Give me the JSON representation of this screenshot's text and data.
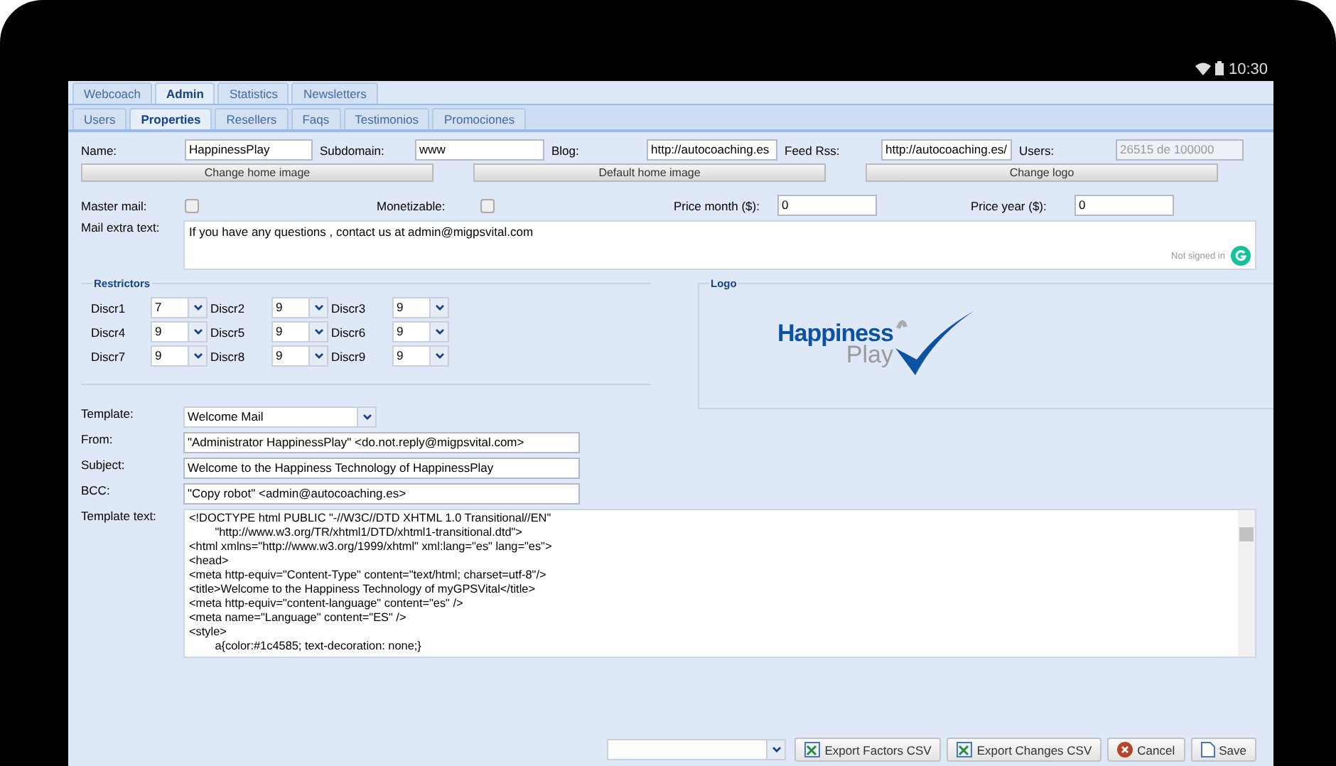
{
  "status_bar": {
    "time": "10:30"
  },
  "main_tabs": [
    {
      "label": "Webcoach",
      "selected": false
    },
    {
      "label": "Admin",
      "selected": true
    },
    {
      "label": "Statistics",
      "selected": false
    },
    {
      "label": "Newsletters",
      "selected": false
    }
  ],
  "sub_tabs": [
    {
      "label": "Users",
      "selected": false
    },
    {
      "label": "Properties",
      "selected": true
    },
    {
      "label": "Resellers",
      "selected": false
    },
    {
      "label": "Faqs",
      "selected": false
    },
    {
      "label": "Testimonios",
      "selected": false
    },
    {
      "label": "Promociones",
      "selected": false
    }
  ],
  "top_fields": [
    {
      "label": "Name:",
      "value": "HappinessPlay",
      "disabled": false
    },
    {
      "label": "Subdomain:",
      "value": "www",
      "disabled": false
    },
    {
      "label": "Blog:",
      "value": "http://autocoaching.es",
      "disabled": false
    },
    {
      "label": "Feed Rss:",
      "value": "http://autocoaching.es/",
      "disabled": false
    },
    {
      "label": "Users:",
      "value": "26515 de 100000",
      "disabled": true
    }
  ],
  "image_buttons": [
    "Change home image",
    "Default home image",
    "Change logo"
  ],
  "checkboxes": [
    {
      "label": "Master mail:",
      "checked": false
    },
    {
      "label": "Monetizable:",
      "checked": false
    }
  ],
  "price_fields": [
    {
      "label": "Price month ($):",
      "value": "0"
    },
    {
      "label": "Price year ($):",
      "value": "0"
    }
  ],
  "mail_extra_text": {
    "label": "Mail extra text:",
    "value": "If you have any questions , contact us at admin@migpsvital.com",
    "grammar_status": "Not signed in"
  },
  "restrictors": {
    "title": "Restrictors",
    "items": [
      {
        "label": "Discr1",
        "value": "7"
      },
      {
        "label": "Discr2",
        "value": "9"
      },
      {
        "label": "Discr3",
        "value": "9"
      },
      {
        "label": "Discr4",
        "value": "9"
      },
      {
        "label": "Discr5",
        "value": "9"
      },
      {
        "label": "Discr6",
        "value": "9"
      },
      {
        "label": "Discr7",
        "value": "9"
      },
      {
        "label": "Discr8",
        "value": "9"
      },
      {
        "label": "Discr9",
        "value": "9"
      }
    ]
  },
  "logo": {
    "title": "Logo",
    "brand_top": "Happiness",
    "brand_bottom": "Play"
  },
  "template_form": {
    "template": {
      "label": "Template:",
      "value": "Welcome Mail"
    },
    "fields": [
      {
        "label": "From:",
        "value": "\"Administrator HappinessPlay\" <do.not.reply@migpsvital.com>"
      },
      {
        "label": "Subject:",
        "value": "Welcome to the Happiness Technology of HappinessPlay"
      },
      {
        "label": "BCC:",
        "value": "\"Copy robot\" <admin@autocoaching.es>"
      }
    ],
    "template_text": {
      "label": "Template text:",
      "lines": [
        "<!DOCTYPE html PUBLIC \"-//W3C//DTD XHTML 1.0 Transitional//EN\"",
        "        \"http://www.w3.org/TR/xhtml1/DTD/xhtml1-transitional.dtd\">",
        "<html xmlns=\"http://www.w3.org/1999/xhtml\" xml:lang=\"es\" lang=\"es\">",
        "<head>",
        "<meta http-equiv=\"Content-Type\" content=\"text/html; charset=utf-8\"/>",
        "<title>Welcome to the Happiness Technology of myGPSVital</title>",
        "<meta http-equiv=\"content-language\" content=\"es\" />",
        "<meta name=\"Language\" content=\"ES\" />",
        "<style>",
        "        a{color:#1c4585; text-decoration: none;}"
      ]
    }
  },
  "footer": {
    "buttons": [
      {
        "label": "Export Factors CSV",
        "kind": "export"
      },
      {
        "label": "Export Changes CSV",
        "kind": "export"
      },
      {
        "label": "Cancel",
        "kind": "cancel"
      },
      {
        "label": "Save",
        "kind": "save"
      }
    ]
  }
}
